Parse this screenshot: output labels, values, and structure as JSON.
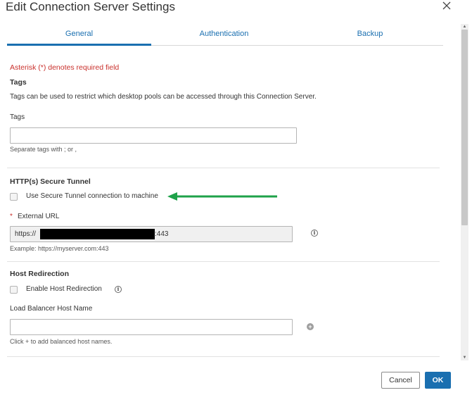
{
  "dialog": {
    "title": "Edit Connection Server Settings"
  },
  "tabs": [
    {
      "label": "General",
      "active": true
    },
    {
      "label": "Authentication",
      "active": false
    },
    {
      "label": "Backup",
      "active": false
    }
  ],
  "form": {
    "required_note": "Asterisk (*) denotes required field",
    "tags_section": {
      "heading": "Tags",
      "description": "Tags can be used to restrict which desktop pools can be accessed through this Connection Server.",
      "field_label": "Tags",
      "value": "",
      "hint": "Separate tags with ; or ,"
    },
    "tunnel_section": {
      "heading": "HTTP(s) Secure Tunnel",
      "checkbox_label": "Use Secure Tunnel connection to machine",
      "checked": false,
      "required_marker": "*",
      "url_label": "External URL",
      "url_prefix": "https://",
      "url_suffix": ":443",
      "url_hint": "Example: https://myserver.com:443"
    },
    "host_section": {
      "heading": "Host Redirection",
      "checkbox_label": "Enable Host Redirection",
      "checked": false,
      "lb_label": "Load Balancer Host Name",
      "lb_value": "",
      "lb_hint": "Click + to add balanced host names."
    }
  },
  "footer": {
    "cancel_label": "Cancel",
    "ok_label": "OK"
  },
  "colors": {
    "accent": "#1a6fb0",
    "required": "#c9302c",
    "annotation_arrow": "#1fa24a"
  },
  "icons": {
    "close": "close-icon",
    "info": "info-icon",
    "add": "plus-icon"
  }
}
